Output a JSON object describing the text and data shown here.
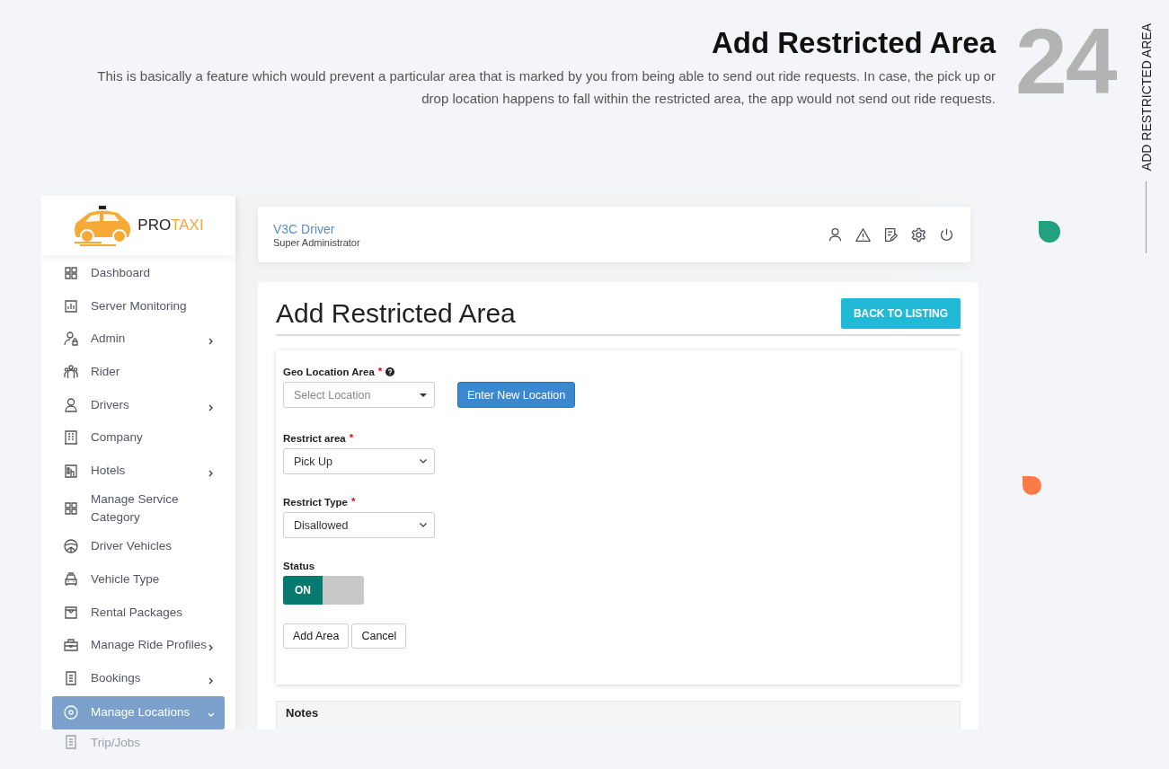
{
  "intro": {
    "title": "Add Restricted Area",
    "description": "This is basically a feature which would prevent a particular area that is marked by you from being able to send out ride requests. In case, the pick up or drop location happens to fall within the restricted area, the app would not send out ride requests.",
    "number": "24",
    "side_label": "ADD RESTRICTED AREA"
  },
  "logo": {
    "prefix": "PRO",
    "suffix": "TAXI"
  },
  "sidebar": {
    "items": [
      {
        "label": "Dashboard",
        "has_submenu": false,
        "selected": false
      },
      {
        "label": "Server Monitoring",
        "has_submenu": false,
        "selected": false
      },
      {
        "label": "Admin",
        "has_submenu": true,
        "selected": false
      },
      {
        "label": "Rider",
        "has_submenu": false,
        "selected": false
      },
      {
        "label": "Drivers",
        "has_submenu": true,
        "selected": false
      },
      {
        "label": "Company",
        "has_submenu": false,
        "selected": false
      },
      {
        "label": "Hotels",
        "has_submenu": true,
        "selected": false
      },
      {
        "label": "Manage Service Category",
        "has_submenu": false,
        "selected": false
      },
      {
        "label": "Driver Vehicles",
        "has_submenu": false,
        "selected": false
      },
      {
        "label": "Vehicle Type",
        "has_submenu": false,
        "selected": false
      },
      {
        "label": "Rental Packages",
        "has_submenu": false,
        "selected": false
      },
      {
        "label": "Manage Ride Profiles",
        "has_submenu": true,
        "selected": false
      },
      {
        "label": "Bookings",
        "has_submenu": true,
        "selected": false
      },
      {
        "label": "Manage Locations",
        "has_submenu": true,
        "selected": true
      }
    ],
    "below_item": "Trip/Jobs"
  },
  "header": {
    "user": "V3C Driver",
    "role": "Super Administrator"
  },
  "page": {
    "title": "Add Restricted Area",
    "back_button": "BACK TO LISTING"
  },
  "form": {
    "geo": {
      "label": "Geo Location Area",
      "required_mark": "*",
      "placeholder": "Select Location",
      "button": "Enter New Location"
    },
    "fields": [
      {
        "label": "Restrict area",
        "required_mark": "*",
        "value": "Pick Up"
      },
      {
        "label": "Restrict Type",
        "required_mark": "*",
        "value": "Disallowed"
      }
    ],
    "status": {
      "label": "Status",
      "on": true,
      "on_text": "ON"
    },
    "buttons": [
      "Add Area",
      "Cancel"
    ]
  },
  "notes": {
    "title": "Notes"
  }
}
